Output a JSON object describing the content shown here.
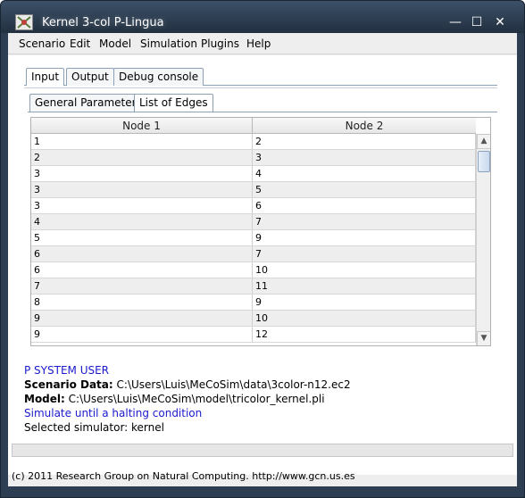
{
  "window": {
    "title": "Kernel 3-col P-Lingua",
    "controls": {
      "minimize": "—",
      "maximize": "☐",
      "close": "✕"
    }
  },
  "menu": [
    "Scenario",
    "Edit",
    "Model",
    "Simulation",
    "Plugins",
    "Help"
  ],
  "tabs": [
    "Input",
    "Output",
    "Debug console"
  ],
  "subtabs": [
    "General Parameters",
    "List of Edges"
  ],
  "table": {
    "headers": [
      "Node 1",
      "Node 2"
    ],
    "rows": [
      [
        "1",
        "2"
      ],
      [
        "2",
        "3"
      ],
      [
        "3",
        "4"
      ],
      [
        "3",
        "5"
      ],
      [
        "3",
        "6"
      ],
      [
        "4",
        "7"
      ],
      [
        "5",
        "9"
      ],
      [
        "6",
        "7"
      ],
      [
        "6",
        "10"
      ],
      [
        "7",
        "11"
      ],
      [
        "8",
        "9"
      ],
      [
        "9",
        "10"
      ],
      [
        "9",
        "12"
      ]
    ]
  },
  "status": {
    "user": "P SYSTEM USER",
    "scenario_label": "Scenario Data:",
    "scenario_value": "C:\\Users\\Luis\\MeCoSim\\data\\3color-n12.ec2",
    "model_label": "Model:",
    "model_value": "C:\\Users\\Luis\\MeCoSim\\model\\tricolor_kernel.pli",
    "simulate": "Simulate until a halting condition",
    "simulator": "Selected simulator: kernel"
  },
  "footer": "(c) 2011 Research Group on Natural Computing. http://www.gcn.us.es",
  "icons": {
    "scroll_up": "up-arrow-icon",
    "scroll_down": "down-arrow-icon"
  },
  "colors": {
    "titlebar": "#2e3e52",
    "status_blue": "#1a1acc"
  }
}
